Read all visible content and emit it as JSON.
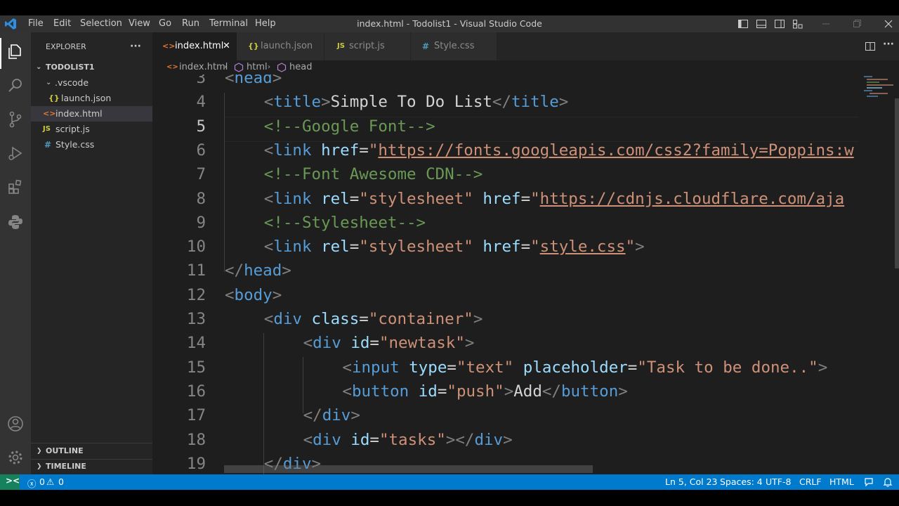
{
  "titlebar": {
    "menus": [
      "File",
      "Edit",
      "Selection",
      "View",
      "Go",
      "Run",
      "Terminal",
      "Help"
    ],
    "title": "index.html - Todolist1 - Visual Studio Code"
  },
  "sidebar": {
    "header": "EXPLORER",
    "more": "···",
    "folder": "TODOLIST1",
    "items": [
      {
        "label": ".vscode",
        "icon": "chevron-down-icon"
      },
      {
        "label": "launch.json",
        "icon": "{}"
      },
      {
        "label": "index.html",
        "icon": "<>"
      },
      {
        "label": "script.js",
        "icon": "JS"
      },
      {
        "label": "Style.css",
        "icon": "#"
      }
    ],
    "outline": "OUTLINE",
    "timeline": "TIMELINE"
  },
  "tabs": [
    {
      "label": "index.html",
      "icon": "<>",
      "active": true,
      "close": "✕"
    },
    {
      "label": "launch.json",
      "icon": "{}"
    },
    {
      "label": "script.js",
      "icon": "JS"
    },
    {
      "label": "Style.css",
      "icon": "#"
    }
  ],
  "breadcrumb": [
    "index.html",
    "html",
    "head"
  ],
  "code": {
    "current_line": 5,
    "lines": [
      {
        "n": 3,
        "indent": 0,
        "tokens": [
          [
            "br",
            "<"
          ],
          [
            "tag",
            "head"
          ],
          [
            "br",
            ">"
          ]
        ]
      },
      {
        "n": 4,
        "indent": 4,
        "tokens": [
          [
            "br",
            "<"
          ],
          [
            "tag",
            "title"
          ],
          [
            "br",
            ">"
          ],
          [
            "txt",
            "Simple To Do List"
          ],
          [
            "br",
            "</"
          ],
          [
            "tag",
            "title"
          ],
          [
            "br",
            ">"
          ]
        ]
      },
      {
        "n": 5,
        "indent": 4,
        "tokens": [
          [
            "cmt",
            "<!--Google Font-->"
          ]
        ]
      },
      {
        "n": 6,
        "indent": 4,
        "tokens": [
          [
            "br",
            "<"
          ],
          [
            "tag",
            "link"
          ],
          [
            "txt",
            " "
          ],
          [
            "attr",
            "href"
          ],
          [
            "txt",
            "="
          ],
          [
            "str",
            "\""
          ],
          [
            "link",
            "https://fonts.googleapis.com/css2?family=Poppins:w"
          ]
        ]
      },
      {
        "n": 7,
        "indent": 4,
        "tokens": [
          [
            "cmt",
            "<!--Font Awesome CDN-->"
          ]
        ]
      },
      {
        "n": 8,
        "indent": 4,
        "tokens": [
          [
            "br",
            "<"
          ],
          [
            "tag",
            "link"
          ],
          [
            "txt",
            " "
          ],
          [
            "attr",
            "rel"
          ],
          [
            "txt",
            "="
          ],
          [
            "str",
            "\"stylesheet\""
          ],
          [
            "txt",
            " "
          ],
          [
            "attr",
            "href"
          ],
          [
            "txt",
            "="
          ],
          [
            "str",
            "\""
          ],
          [
            "link",
            "https://cdnjs.cloudflare.com/aja"
          ]
        ]
      },
      {
        "n": 9,
        "indent": 4,
        "tokens": [
          [
            "cmt",
            "<!--Stylesheet-->"
          ]
        ]
      },
      {
        "n": 10,
        "indent": 4,
        "tokens": [
          [
            "br",
            "<"
          ],
          [
            "tag",
            "link"
          ],
          [
            "txt",
            " "
          ],
          [
            "attr",
            "rel"
          ],
          [
            "txt",
            "="
          ],
          [
            "str",
            "\"stylesheet\""
          ],
          [
            "txt",
            " "
          ],
          [
            "attr",
            "href"
          ],
          [
            "txt",
            "="
          ],
          [
            "str",
            "\""
          ],
          [
            "link",
            "style.css"
          ],
          [
            "str",
            "\""
          ],
          [
            "br",
            ">"
          ]
        ]
      },
      {
        "n": 11,
        "indent": 0,
        "tokens": [
          [
            "br",
            "</"
          ],
          [
            "tag",
            "head"
          ],
          [
            "br",
            ">"
          ]
        ]
      },
      {
        "n": 12,
        "indent": 0,
        "tokens": [
          [
            "br",
            "<"
          ],
          [
            "tag",
            "body"
          ],
          [
            "br",
            ">"
          ]
        ]
      },
      {
        "n": 13,
        "indent": 4,
        "tokens": [
          [
            "br",
            "<"
          ],
          [
            "tag",
            "div"
          ],
          [
            "txt",
            " "
          ],
          [
            "attr",
            "class"
          ],
          [
            "txt",
            "="
          ],
          [
            "str",
            "\"container\""
          ],
          [
            "br",
            ">"
          ]
        ]
      },
      {
        "n": 14,
        "indent": 8,
        "tokens": [
          [
            "br",
            "<"
          ],
          [
            "tag",
            "div"
          ],
          [
            "txt",
            " "
          ],
          [
            "attr",
            "id"
          ],
          [
            "txt",
            "="
          ],
          [
            "str",
            "\"newtask\""
          ],
          [
            "br",
            ">"
          ]
        ]
      },
      {
        "n": 15,
        "indent": 12,
        "tokens": [
          [
            "br",
            "<"
          ],
          [
            "tag",
            "input"
          ],
          [
            "txt",
            " "
          ],
          [
            "attr",
            "type"
          ],
          [
            "txt",
            "="
          ],
          [
            "str",
            "\"text\""
          ],
          [
            "txt",
            " "
          ],
          [
            "attr",
            "placeholder"
          ],
          [
            "txt",
            "="
          ],
          [
            "str",
            "\"Task to be done..\""
          ],
          [
            "br",
            ">"
          ]
        ]
      },
      {
        "n": 16,
        "indent": 12,
        "tokens": [
          [
            "br",
            "<"
          ],
          [
            "tag",
            "button"
          ],
          [
            "txt",
            " "
          ],
          [
            "attr",
            "id"
          ],
          [
            "txt",
            "="
          ],
          [
            "str",
            "\"push\""
          ],
          [
            "br",
            ">"
          ],
          [
            "txt",
            "Add"
          ],
          [
            "br",
            "</"
          ],
          [
            "tag",
            "button"
          ],
          [
            "br",
            ">"
          ]
        ]
      },
      {
        "n": 17,
        "indent": 8,
        "tokens": [
          [
            "br",
            "</"
          ],
          [
            "tag",
            "div"
          ],
          [
            "br",
            ">"
          ]
        ]
      },
      {
        "n": 18,
        "indent": 8,
        "tokens": [
          [
            "br",
            "<"
          ],
          [
            "tag",
            "div"
          ],
          [
            "txt",
            " "
          ],
          [
            "attr",
            "id"
          ],
          [
            "txt",
            "="
          ],
          [
            "str",
            "\"tasks\""
          ],
          [
            "br",
            "></"
          ],
          [
            "tag",
            "div"
          ],
          [
            "br",
            ">"
          ]
        ]
      },
      {
        "n": 19,
        "indent": 4,
        "tokens": [
          [
            "br",
            "</"
          ],
          [
            "tag",
            "div"
          ],
          [
            "br",
            ">"
          ]
        ]
      }
    ]
  },
  "status": {
    "remote": "><",
    "errors": "0",
    "warnings": "0",
    "position": "Ln 5, Col 23",
    "spaces": "Spaces: 4",
    "encoding": "UTF-8",
    "eol": "CRLF",
    "language": "HTML"
  },
  "colors": {
    "accent": "#007acc",
    "editor_bg": "#1e1e1e",
    "sidebar_bg": "#252526",
    "activity_bg": "#333333"
  }
}
